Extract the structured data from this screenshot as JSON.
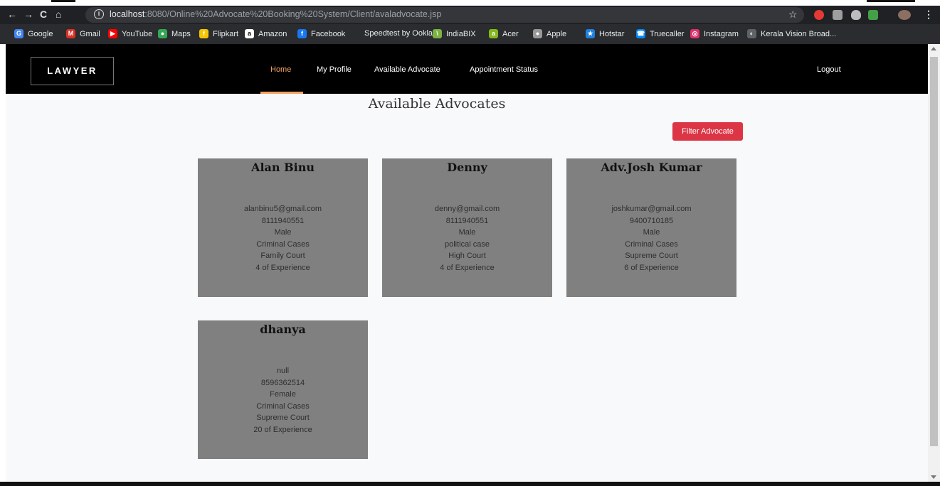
{
  "browser": {
    "url_host": "localhost",
    "url_path": ":8080/Online%20Advocate%20Booking%20System/Client/avaladvocate.jsp",
    "nav_back": "←",
    "nav_forward": "→",
    "nav_reload": "C",
    "nav_home": "⌂",
    "star": "☆",
    "menu": "⋮",
    "bookmarks": [
      {
        "label": "Google",
        "icon": "google-icon",
        "color": "#4285f4",
        "glyph": "G"
      },
      {
        "label": "Gmail",
        "icon": "gmail-icon",
        "color": "#d93025",
        "glyph": "M"
      },
      {
        "label": "YouTube",
        "icon": "youtube-icon",
        "color": "#ff0000",
        "glyph": "▶"
      },
      {
        "label": "Maps",
        "icon": "maps-icon",
        "color": "#34a853",
        "glyph": "●"
      },
      {
        "label": "Flipkart",
        "icon": "flipkart-icon",
        "color": "#f7c600",
        "glyph": "f"
      },
      {
        "label": "Amazon",
        "icon": "amazon-icon",
        "color": "#ffffff",
        "glyph": "a"
      },
      {
        "label": "Facebook",
        "icon": "facebook-icon",
        "color": "#1877f2",
        "glyph": "f"
      },
      {
        "label": "Speedtest by Ookla...",
        "icon": "speedtest-icon",
        "color": "#2b2c2f",
        "glyph": ""
      },
      {
        "label": "IndiaBIX",
        "icon": "indiabix-icon",
        "color": "#7cb342",
        "glyph": "\\"
      },
      {
        "label": "Acer",
        "icon": "acer-icon",
        "color": "#83b81a",
        "glyph": "a"
      },
      {
        "label": "Apple",
        "icon": "apple-icon",
        "color": "#999999",
        "glyph": "●"
      },
      {
        "label": "Hotstar",
        "icon": "hotstar-icon",
        "color": "#1f80e0",
        "glyph": "★"
      },
      {
        "label": "Truecaller",
        "icon": "truecaller-icon",
        "color": "#0087ff",
        "glyph": "☎"
      },
      {
        "label": "Instagram",
        "icon": "instagram-icon",
        "color": "#e1306c",
        "glyph": "◎"
      },
      {
        "label": "Kerala Vision Broad...",
        "icon": "globe-icon",
        "color": "#5f6368",
        "glyph": "◐"
      }
    ]
  },
  "navbar": {
    "brand": "LAWYER",
    "links": [
      {
        "label": "Home",
        "active": true
      },
      {
        "label": "My Profile",
        "active": false
      },
      {
        "label": "Available Advocate",
        "active": false
      },
      {
        "label": "Appointment Status",
        "active": false
      }
    ],
    "logout": "Logout"
  },
  "page": {
    "title": "Available Advocates",
    "filter_button": "Filter Advocate"
  },
  "advocates": [
    {
      "name": "Alan Binu",
      "email": "alanbinu5@gmail.com",
      "phone": "8111940551",
      "gender": "Male",
      "case_type": "Criminal Cases",
      "court": "Family Court",
      "experience": "4 of Experience"
    },
    {
      "name": "Denny",
      "email": "denny@gmail.com",
      "phone": "8111940551",
      "gender": "Male",
      "case_type": "political case",
      "court": "High Court",
      "experience": "4 of Experience"
    },
    {
      "name": "Adv.Josh Kumar",
      "email": "joshkumar@gmail.com",
      "phone": "9400710185",
      "gender": "Male",
      "case_type": "Criminal Cases",
      "court": "Supreme Court",
      "experience": "6 of Experience"
    },
    {
      "name": "dhanya",
      "email": "null",
      "phone": "8596362514",
      "gender": "Female",
      "case_type": "Criminal Cases",
      "court": "Supreme Court",
      "experience": "20 of Experience"
    }
  ]
}
